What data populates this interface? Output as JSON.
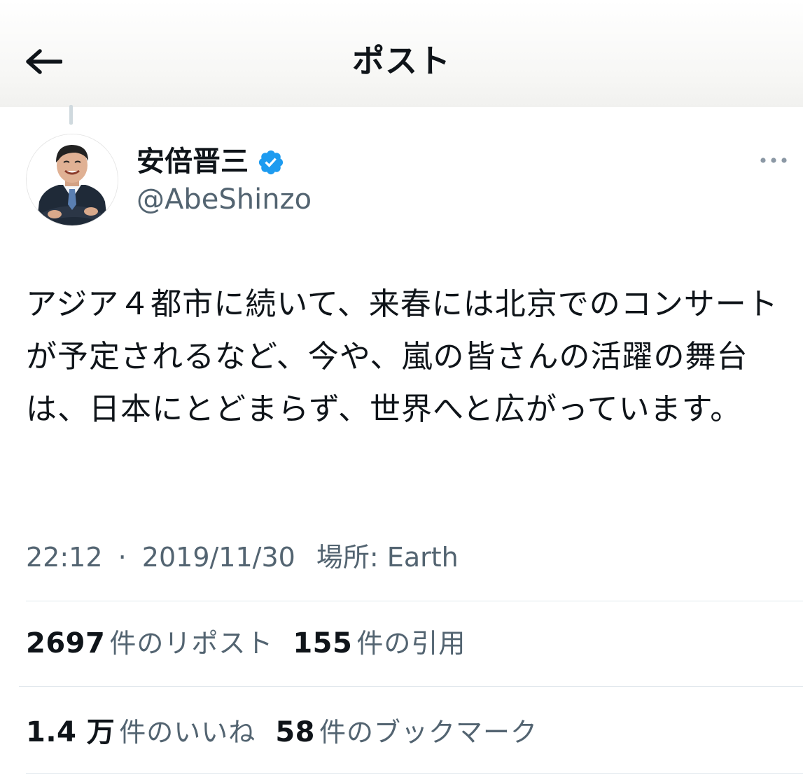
{
  "header": {
    "title": "ポスト",
    "back_icon": "arrow-left-icon"
  },
  "author": {
    "display_name": "安倍晋三",
    "handle": "@AbeShinzo",
    "verified": true,
    "verified_icon": "verified-badge-icon",
    "verified_color": "#1d9bf0",
    "avatar_icon": "profile-photo-icon",
    "more_icon": "more-horizontal-icon"
  },
  "tweet": {
    "text": "アジア４都市に続いて、来春には北京でのコンサートが予定されるなど、今や、嵐の皆さんの活躍の舞台は、日本にとどまらず、世界へと広がっています。"
  },
  "meta": {
    "time": "22:12",
    "separator": "·",
    "date": "2019/11/30",
    "location": "場所: Earth"
  },
  "stats": {
    "reposts": {
      "count": "2697",
      "label": "件のリポスト"
    },
    "quotes": {
      "count": "155",
      "label": "件の引用"
    },
    "likes": {
      "count": "1.4 万",
      "label": "件のいいね"
    },
    "bookmarks": {
      "count": "58",
      "label": "件のブックマーク"
    }
  },
  "colors": {
    "text_primary": "#0f1419",
    "text_secondary": "#536471",
    "divider": "#e1e8ed",
    "accent": "#1d9bf0"
  }
}
